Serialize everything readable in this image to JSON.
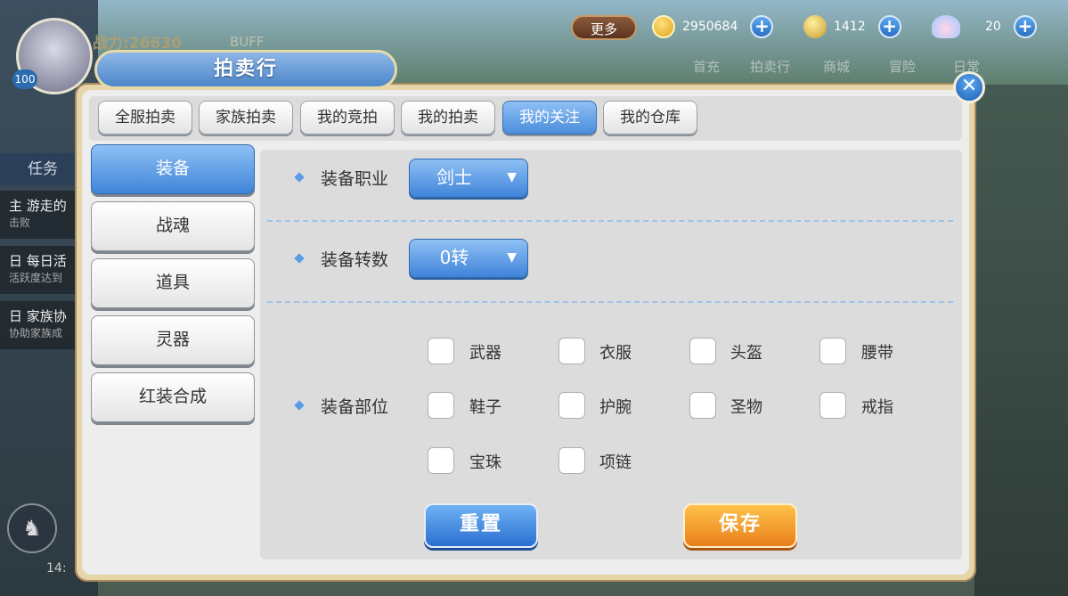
{
  "hud": {
    "power": "战力:26630",
    "buff": "BUFF",
    "level": "100",
    "task_tab": "任务",
    "quests": [
      {
        "title": "主 游走的",
        "desc": "击败"
      },
      {
        "title": "日 每日活",
        "desc": "活跃度达到"
      },
      {
        "title": "日 家族协",
        "desc": "协助家族成"
      }
    ],
    "time": "14:"
  },
  "topbar": {
    "more_label": "更多",
    "gold": "2950684",
    "coins": "1412",
    "shells": "20",
    "nav": [
      "首充",
      "拍卖行",
      "商城",
      "冒险",
      "日常"
    ]
  },
  "panel": {
    "title": "拍卖行",
    "tabs": [
      "全服拍卖",
      "家族拍卖",
      "我的竞拍",
      "我的拍卖",
      "我的关注",
      "我的仓库"
    ],
    "active_tab": "我的关注",
    "sidebar": [
      "装备",
      "战魂",
      "道具",
      "灵器",
      "红装合成"
    ],
    "active_side": "装备"
  },
  "filters": {
    "class_label": "装备职业",
    "class_value": "剑士",
    "rebirth_label": "装备转数",
    "rebirth_value": "0转",
    "slot_label": "装备部位",
    "slots": [
      "武器",
      "衣服",
      "头盔",
      "腰带",
      "鞋子",
      "护腕",
      "圣物",
      "戒指",
      "宝珠",
      "项链"
    ]
  },
  "actions": {
    "reset": "重置",
    "save": "保存"
  }
}
